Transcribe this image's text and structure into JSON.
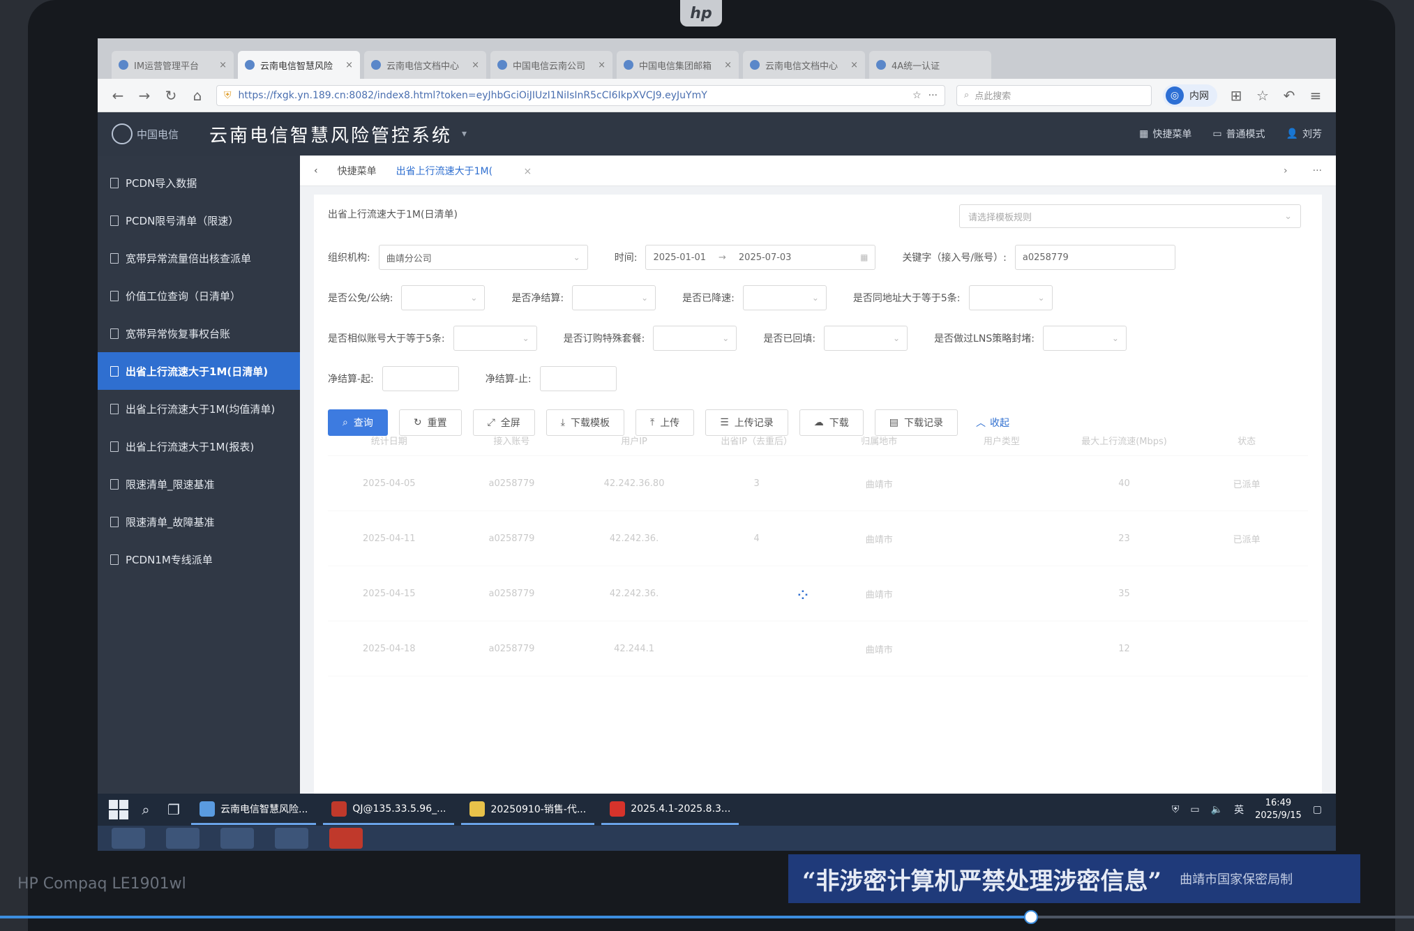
{
  "bezel": {
    "hp_logo": "hp",
    "model": "HP Compaq LE1901wl"
  },
  "notice": {
    "slogan": "“非涉密计算机严禁处理涉密信息”",
    "issuer": "曲靖市国家保密局制"
  },
  "browser": {
    "tabs": [
      {
        "label": "IM运营管理平台",
        "active": false
      },
      {
        "label": "云南电信智慧风险",
        "active": true
      },
      {
        "label": "云南电信文档中心",
        "active": false
      },
      {
        "label": "中国电信云南公司",
        "active": false
      },
      {
        "label": "中国电信集团邮箱",
        "active": false
      },
      {
        "label": "云南电信文档中心",
        "active": false
      },
      {
        "label": "4A统一认证",
        "active": false
      }
    ],
    "url": "https://fxgk.yn.189.cn:8082/index8.html?token=eyJhbGciOiJIUzI1NiIsInR5cCI6IkpXVCJ9.eyJuYmY",
    "search_placeholder": "点此搜索",
    "intranet_label": "内网"
  },
  "app": {
    "title": "云南电信智慧风险管控系统",
    "logo_text": "中国电信",
    "header_actions": [
      "快捷菜单",
      "普通模式",
      "刘芳"
    ]
  },
  "sidebar": {
    "items": [
      {
        "label": "PCDN导入数据",
        "active": false
      },
      {
        "label": "PCDN限号清单（限速）",
        "active": false
      },
      {
        "label": "宽带异常流量倍出核查派单",
        "active": false
      },
      {
        "label": "价值工位查询（日清单）",
        "active": false
      },
      {
        "label": "宽带异常恢复事权台账",
        "active": false
      },
      {
        "label": "出省上行流速大于1M(日清单)",
        "active": true
      },
      {
        "label": "出省上行流速大于1M(均值清单)",
        "active": false
      },
      {
        "label": "出省上行流速大于1M(报表)",
        "active": false
      },
      {
        "label": "限速清单_限速基准",
        "active": false
      },
      {
        "label": "限速清单_故障基准",
        "active": false
      },
      {
        "label": "PCDN1M专线派单",
        "active": false
      }
    ]
  },
  "page_tabs": {
    "back": "‹",
    "quick_menu": "快捷菜单",
    "current": "出省上行流速大于1M(",
    "close": "×",
    "next": "›",
    "more": "···"
  },
  "panel": {
    "title": "出省上行流速大于1M(日清单)",
    "rule_placeholder": "请选择模板规则",
    "filters": {
      "org_label": "组织机构:",
      "org_value": "曲靖分公司",
      "time_label": "时间:",
      "date_start": "2025-01-01",
      "date_sep": "→",
      "date_end": "2025-07-03",
      "keyword_label": "关键字（接入号/账号）:",
      "keyword_value": "a0258779",
      "public_label": "是否公免/公纳:",
      "settle_label": "是否净结算:",
      "slowed_label": "是否已降速:",
      "ip_label": "是否同地址大于等于5条:",
      "account_label": "是否相似账号大于等于5条:",
      "package_label": "是否订购特殊套餐:",
      "reply_label": "是否已回填:",
      "lns_label": "是否做过LNS策略封堵:",
      "settle_from_label": "净结算-起:",
      "settle_to_label": "净结算-止:"
    },
    "buttons": {
      "query": "查询",
      "reset": "重置",
      "fullscreen": "全屏",
      "download_template": "下载模板",
      "upload": "上传",
      "upload_log": "上传记录",
      "download": "下载",
      "download_log": "下载记录",
      "collapse": "收起"
    },
    "table": {
      "headers": [
        "统计日期",
        "接入账号",
        "用户IP",
        "出省IP（去重后）",
        "归属地市",
        "用户类型",
        "最大上行流速(Mbps)",
        "状态"
      ],
      "rows": [
        [
          "2025-04-05",
          "a0258779",
          "42.242.36.80",
          "3",
          "曲靖市",
          "",
          "40",
          "已派单"
        ],
        [
          "2025-04-11",
          "a0258779",
          "42.242.36.",
          "4",
          "曲靖市",
          "",
          "23",
          "已派单"
        ],
        [
          "2025-04-15",
          "a0258779",
          "42.242.36.",
          "",
          "曲靖市",
          "",
          "35",
          ""
        ],
        [
          "2025-04-18",
          "a0258779",
          "42.244.1",
          "",
          "曲靖市",
          "",
          "12",
          ""
        ]
      ]
    }
  },
  "taskbar": {
    "tasks": [
      "云南电信智慧风险...",
      "QJ@135.33.5.96_...",
      "20250910-销售-代...",
      "2025.4.1-2025.8.3..."
    ],
    "lang": "英",
    "time": "16:49",
    "date": "2025/9/15"
  }
}
